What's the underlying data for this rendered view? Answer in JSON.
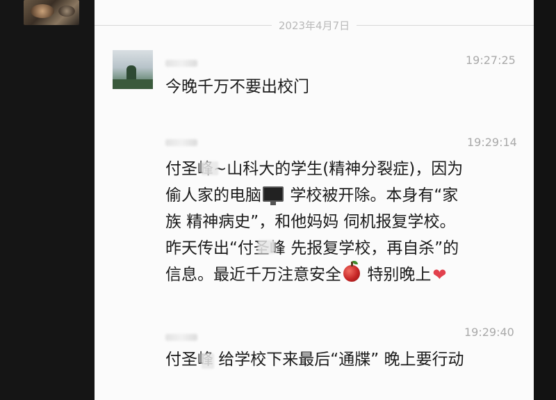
{
  "chat": {
    "date_separator": "2023年4月7日",
    "messages": [
      {
        "time": "19:27:25",
        "lines": [
          "今晚千万不要出校门"
        ]
      },
      {
        "time": "19:29:14",
        "lines": [
          "付圣峰~山科大的学生(精神分裂症)，因为",
          "偷人家的电脑",
          "学校被开除。本身有“家",
          "族 精神病史”，和他妈妈 伺机报复学校。",
          "昨天传出“付圣峰 先报复学校，再自杀”的",
          "信息。最近千万注意安全",
          "特别晚上"
        ]
      },
      {
        "time": "19:29:40",
        "lines": [
          "付圣峰 给学校下来最后“通牒” 晚上要行动"
        ]
      }
    ],
    "emoji": {
      "monitor": "desktop-computer-emoji",
      "apple": "red-apple-emoji",
      "heart": "❤"
    }
  }
}
